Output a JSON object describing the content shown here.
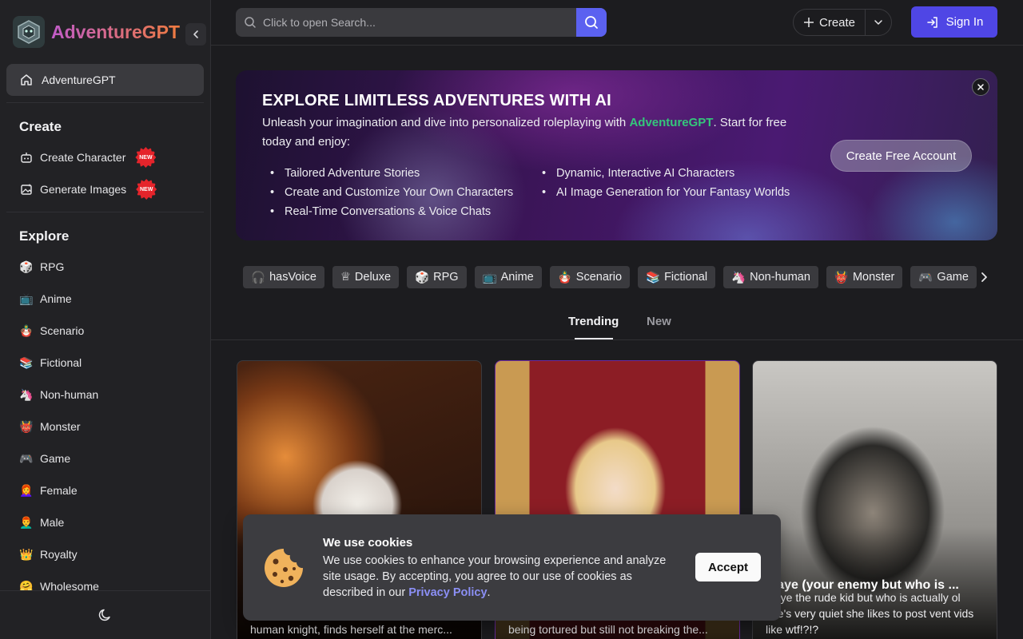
{
  "brand": {
    "name": "AdventureGPT"
  },
  "sidebar": {
    "home": "AdventureGPT",
    "create_title": "Create",
    "create_items": [
      {
        "label": "Create Character",
        "badge": "NEW"
      },
      {
        "label": "Generate Images",
        "badge": "NEW"
      }
    ],
    "explore_title": "Explore",
    "explore_items": [
      {
        "emoji": "🎲",
        "label": "RPG"
      },
      {
        "emoji": "📺",
        "label": "Anime"
      },
      {
        "emoji": "🪆",
        "label": "Scenario"
      },
      {
        "emoji": "📚",
        "label": "Fictional"
      },
      {
        "emoji": "🦄",
        "label": "Non-human"
      },
      {
        "emoji": "👹",
        "label": "Monster"
      },
      {
        "emoji": "🎮",
        "label": "Game"
      },
      {
        "emoji": "👩‍🦰",
        "label": "Female"
      },
      {
        "emoji": "👨‍🦰",
        "label": "Male"
      },
      {
        "emoji": "👑",
        "label": "Royalty"
      },
      {
        "emoji": "🤗",
        "label": "Wholesome"
      }
    ]
  },
  "topbar": {
    "search_placeholder": "Click to open Search...",
    "create_label": "Create",
    "signin_label": "Sign In"
  },
  "banner": {
    "title": "EXPLORE LIMITLESS ADVENTURES WITH AI",
    "desc_before": "Unleash your imagination and dive into personalized roleplaying with ",
    "desc_highlight": "AdventureGPT",
    "desc_after": ". Start for free today and enjoy:",
    "bullets": [
      "Tailored Adventure Stories",
      "Dynamic, Interactive AI Characters",
      "Create and Customize Your Own Characters",
      "AI Image Generation for Your Fantasy Worlds",
      "Real-Time Conversations & Voice Chats"
    ],
    "cta": "Create Free Account"
  },
  "tags": [
    {
      "emoji": "🎧",
      "label": "hasVoice"
    },
    {
      "emoji": "♕",
      "label": "Deluxe"
    },
    {
      "emoji": "🎲",
      "label": "RPG"
    },
    {
      "emoji": "📺",
      "label": "Anime"
    },
    {
      "emoji": "🪆",
      "label": "Scenario"
    },
    {
      "emoji": "📚",
      "label": "Fictional"
    },
    {
      "emoji": "🦄",
      "label": "Non-human"
    },
    {
      "emoji": "👹",
      "label": "Monster"
    },
    {
      "emoji": "🎮",
      "label": "Game"
    }
  ],
  "tabs": {
    "trending": "Trending",
    "new": "New"
  },
  "cards": [
    {
      "title": "",
      "text": "human knight, finds herself at the merc..."
    },
    {
      "title": "",
      "text": "being tortured but still not breaking the..."
    },
    {
      "title": "inaye (your enemy but who is ...",
      "text": "inaye the rude kid but who is actually ol she's very quiet she likes to post vent vids like wtf!?!?"
    }
  ],
  "cookie": {
    "title": "We use cookies",
    "body": "We use cookies to enhance your browsing experience and analyze site usage. By accepting, you agree to our use of cookies as described in our ",
    "link": "Privacy Policy",
    "body_end": ".",
    "accept": "Accept"
  },
  "colors": {
    "accent": "#4f46e5",
    "highlight": "#34c77b",
    "badge": "#e5242b"
  }
}
